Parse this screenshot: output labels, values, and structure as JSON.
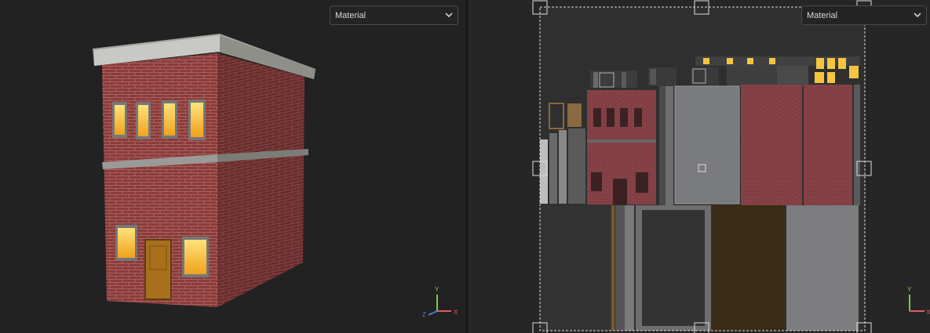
{
  "viewport3d": {
    "material_dropdown": {
      "selected": "Material"
    },
    "axis_gizmo": {
      "y_label": "Y",
      "z_label": "Z",
      "x_label": "X"
    }
  },
  "uv_editor": {
    "material_dropdown": {
      "selected": "Material"
    },
    "axis_gizmo": {
      "y_label": "Y",
      "x_label": "X"
    }
  },
  "colors": {
    "brick": "#8a3a3a",
    "window_glow": "#f5c542",
    "panel_bg": "#222222",
    "uv_bg": "#262626",
    "gizmo_x": "#e05a6a",
    "gizmo_y": "#7ec850",
    "gizmo_z": "#4a7fd6"
  }
}
